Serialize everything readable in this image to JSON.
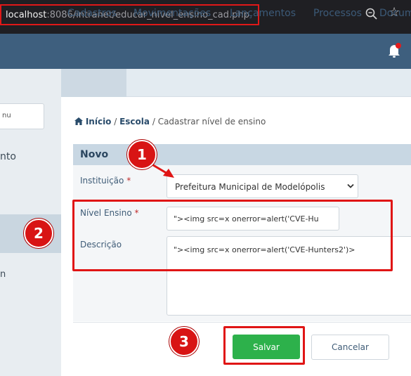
{
  "browser": {
    "url_host": "localhost",
    "url_rest": ":8086/intranet/educar_nivel_ensino_cad.php"
  },
  "sidebar": {
    "search_placeholder": "nu",
    "item_1": "nto",
    "item_2": "n"
  },
  "nav": {
    "items": [
      "Cadastros",
      "Movimentações",
      "Lançamentos",
      "Processos",
      "Docum"
    ]
  },
  "breadcrumb": {
    "home": "Início",
    "sep1": " / ",
    "escola": "Escola",
    "sep2": " / ",
    "current": "Cadastrar nível de ensino"
  },
  "form": {
    "title": "Novo",
    "instituicao_label": "Instituição",
    "instituicao_value": "Prefeitura Municipal de Modelópolis",
    "nivel_label": "Nível Ensino",
    "nivel_value": "\"><img src=x onerror=alert('CVE-Hu",
    "descricao_label": "Descrição",
    "descricao_value": "\"><img src=x onerror=alert('CVE-Hunters2')>",
    "required_mark": "*",
    "save_label": "Salvar",
    "cancel_label": "Cancelar"
  },
  "annotations": {
    "badge_1": "1",
    "badge_2": "2",
    "badge_3": "3"
  },
  "icons": {
    "home": "home-icon",
    "zoom": "zoom-icon",
    "star": "star-icon",
    "bell": "bell-icon"
  },
  "colors": {
    "header": "#3e5f7e",
    "annotation": "#e01515",
    "save": "#2db14b"
  }
}
